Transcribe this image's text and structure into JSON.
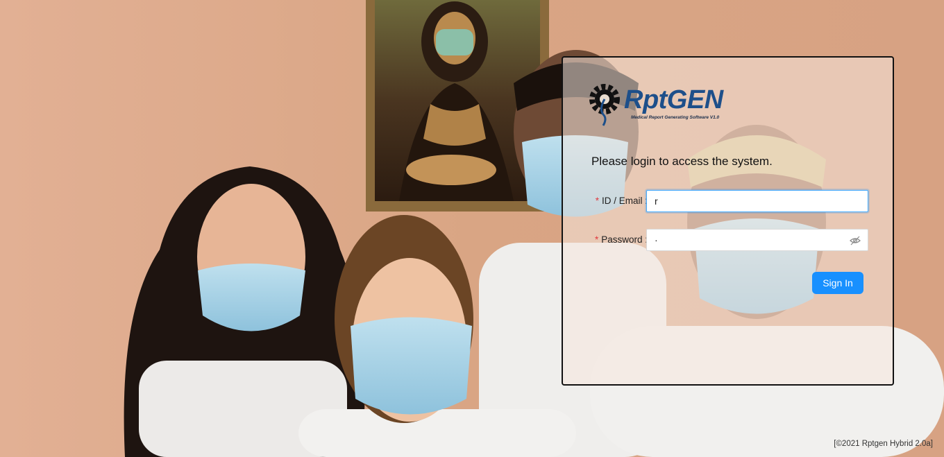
{
  "logo": {
    "title": "RptGEN",
    "subtitle": "Medical Report Generating Software V1.0",
    "icon": "gear-pin-icon"
  },
  "login": {
    "heading": "Please login to access the system.",
    "id_field": {
      "required_mark": "*",
      "label": "ID / Email :",
      "value": "r"
    },
    "password_field": {
      "required_mark": "*",
      "label": "Password :",
      "value": "·",
      "toggle_icon": "eye-invisible-icon"
    },
    "submit_label": "Sign In"
  },
  "footer": {
    "copyright": "[©2021 Rptgen Hybrid 2.0a]"
  },
  "colors": {
    "primary": "#1890ff",
    "required": "#e0383e",
    "logo_blue": "#1d4f8a",
    "wall": "#dba88a"
  }
}
